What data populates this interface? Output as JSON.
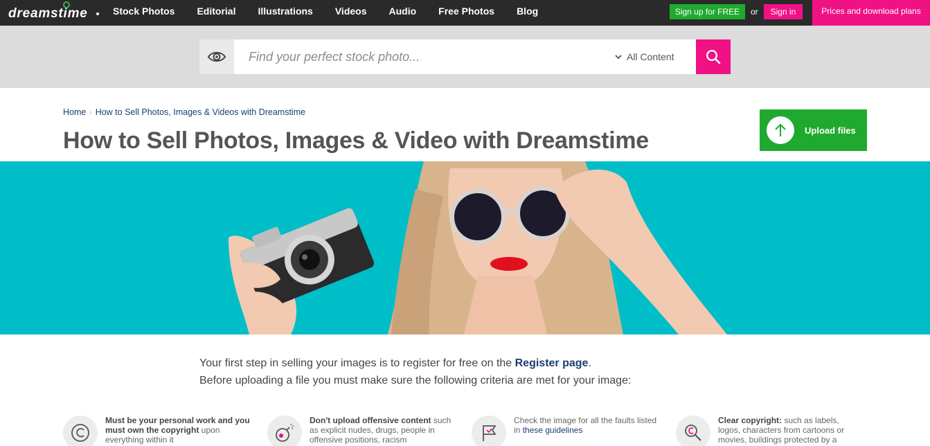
{
  "header": {
    "logo_text": "dreamstime",
    "nav": [
      "Stock Photos",
      "Editorial",
      "Illustrations",
      "Videos",
      "Audio",
      "Free Photos",
      "Blog"
    ],
    "signup_label": "Sign up for FREE",
    "or_text": "or",
    "signin_label": "Sign in",
    "prices_label": "Prices and download plans"
  },
  "search": {
    "placeholder": "Find your perfect stock photo...",
    "filter_value": "All Content"
  },
  "breadcrumb": {
    "home": "Home",
    "current": "How to Sell Photos, Images & Videos with Dreamstime"
  },
  "page": {
    "title": "How to Sell Photos, Images & Video with Dreamstime",
    "upload_label": "Upload files"
  },
  "intro": {
    "line1_prefix": "Your first step in selling your images is to register for free on the ",
    "register_link": "Register page",
    "line1_suffix": ".",
    "line2": "Before uploading a file you must make sure the following criteria are met for your image:"
  },
  "criteria": [
    {
      "bold": "Must be your personal work and you must own the copyright",
      "text": " upon everything within it"
    },
    {
      "bold": "Don't upload offensive content",
      "text": " such as explicit nudes, drugs, people in offensive positions, racism"
    },
    {
      "text_before": "Check the image for all the faults listed in ",
      "link": "these guidelines"
    },
    {
      "bold": "Clear copyright:",
      "text": " such as labels, logos, characters from cartoons or movies, buildings protected by a trademark"
    }
  ],
  "colors": {
    "topbar": "#2a2a2a",
    "brand_green": "#1faa2f",
    "brand_pink": "#f01185",
    "hero_teal": "#00bec7",
    "link_blue": "#1a3f6f"
  }
}
